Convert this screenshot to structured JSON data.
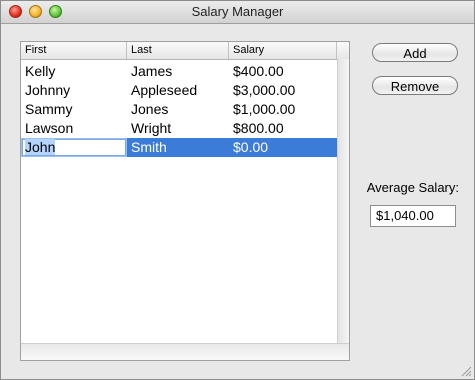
{
  "window": {
    "title": "Salary Manager"
  },
  "table": {
    "columns": [
      "First",
      "Last",
      "Salary"
    ],
    "rows": [
      {
        "first": "Kelly",
        "last": "James",
        "salary": "$400.00"
      },
      {
        "first": "Johnny",
        "last": "Appleseed",
        "salary": "$3,000.00"
      },
      {
        "first": "Sammy",
        "last": "Jones",
        "salary": "$1,000.00"
      },
      {
        "first": "Lawson",
        "last": "Wright",
        "salary": "$800.00"
      },
      {
        "first": "John",
        "last": "Smith",
        "salary": "$0.00",
        "selected": true,
        "editing_first": true
      }
    ]
  },
  "buttons": {
    "add": "Add",
    "remove": "Remove"
  },
  "average": {
    "label": "Average Salary:",
    "value": "$1,040.00"
  },
  "colors": {
    "selection": "#3c7cd9",
    "edit_highlight": "#b5d3ff"
  }
}
